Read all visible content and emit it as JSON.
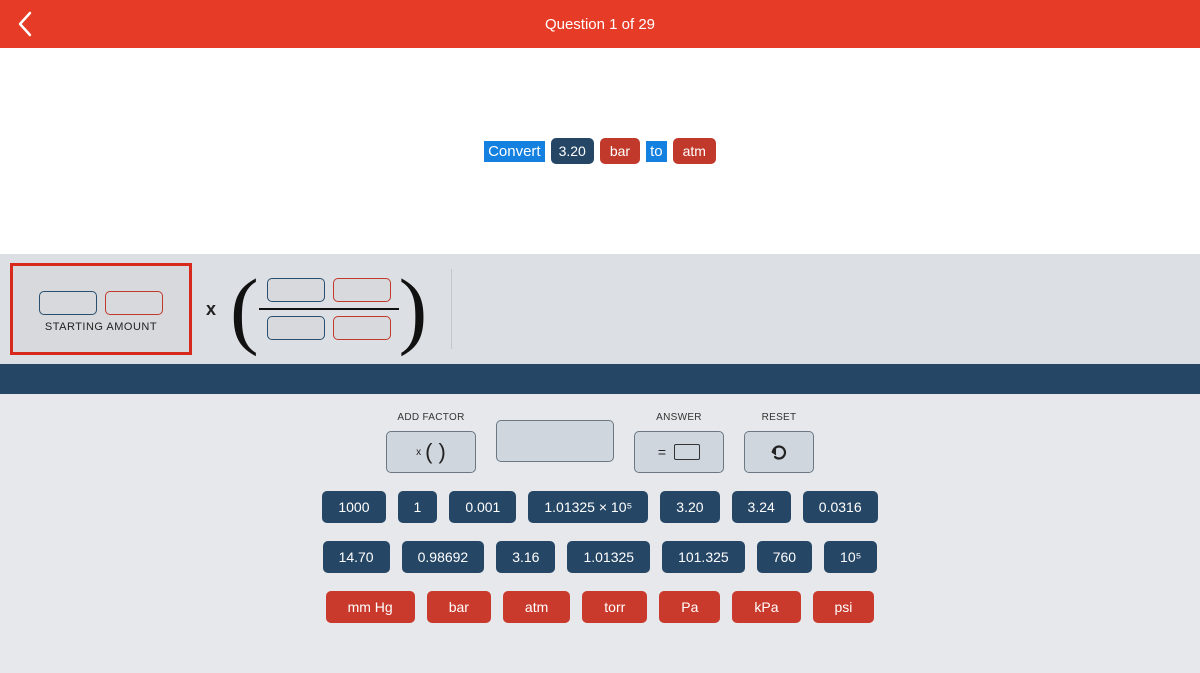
{
  "header": {
    "title": "Question 1 of 29"
  },
  "question": {
    "convert_label": "Convert",
    "value": "3.20",
    "from_unit": "bar",
    "to_label": "to",
    "to_unit": "atm"
  },
  "equation": {
    "starting_label": "STARTING AMOUNT",
    "times": "x"
  },
  "actions": {
    "add_factor_label": "ADD FACTOR",
    "add_factor_x": "x",
    "add_factor_parens": "(    )",
    "answer_label": "ANSWER",
    "answer_eq": "=",
    "reset_label": "RESET",
    "blank_label": ""
  },
  "numbers_row1": [
    "1000",
    "1",
    "0.001",
    "1.01325 × 10⁵",
    "3.20",
    "3.24",
    "0.0316"
  ],
  "numbers_row2": [
    "14.70",
    "0.98692",
    "3.16",
    "1.01325",
    "101.325",
    "760",
    "10⁵"
  ],
  "units": [
    "mm Hg",
    "bar",
    "atm",
    "torr",
    "Pa",
    "kPa",
    "psi"
  ]
}
